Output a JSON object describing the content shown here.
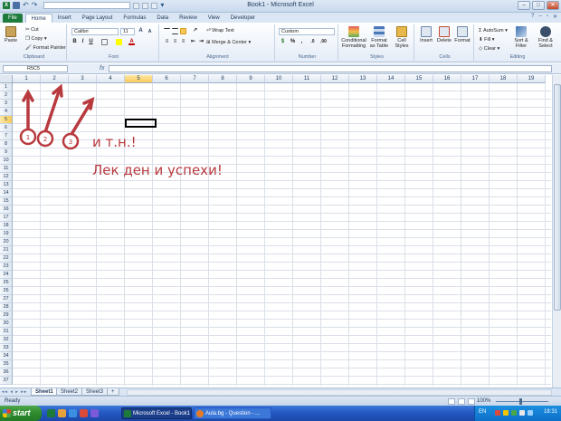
{
  "window": {
    "title": "Book1 - Microsoft Excel"
  },
  "ribbon_tabs": [
    "File",
    "Home",
    "Insert",
    "Page Layout",
    "Formulas",
    "Data",
    "Review",
    "View",
    "Developer"
  ],
  "clipboard": {
    "paste": "Paste",
    "cut": "Cut",
    "copy": "Copy",
    "format_painter": "Format Painter",
    "label": "Clipboard"
  },
  "font": {
    "name": "Calibri",
    "size": "11",
    "label": "Font"
  },
  "alignment": {
    "wrap_text": "Wrap Text",
    "merge_center": "Merge & Center",
    "label": "Alignment"
  },
  "number": {
    "format": "Custom",
    "label": "Number"
  },
  "styles": {
    "conditional": "Conditional Formatting",
    "format_table": "Format as Table",
    "cell_styles": "Cell Styles",
    "label": "Styles"
  },
  "cells_group": {
    "insert": "Insert",
    "delete": "Delete",
    "format": "Format",
    "label": "Cells"
  },
  "editing": {
    "autosum": "AutoSum",
    "fill": "Fill",
    "clear": "Clear",
    "sort_filter": "Sort & Filter",
    "find_select": "Find & Select",
    "label": "Editing"
  },
  "formula_bar": {
    "name_box": "R5C5",
    "fx": "fx",
    "value": ""
  },
  "grid": {
    "columns": [
      "1",
      "2",
      "3",
      "4",
      "5",
      "6",
      "7",
      "8",
      "9",
      "10",
      "11",
      "12",
      "13",
      "14",
      "15",
      "16",
      "17",
      "18",
      "19"
    ],
    "rows": [
      "1",
      "2",
      "3",
      "4",
      "5",
      "6",
      "7",
      "8",
      "9",
      "10",
      "11",
      "12",
      "13",
      "14",
      "15",
      "16",
      "17",
      "18",
      "19",
      "20",
      "21",
      "22",
      "23",
      "24",
      "25",
      "26",
      "27",
      "28",
      "29",
      "30",
      "31",
      "32",
      "33",
      "34",
      "35",
      "36",
      "37"
    ],
    "selected_column": "5",
    "selected_row": "5"
  },
  "annotation": {
    "circle_labels": [
      "1",
      "2",
      "3"
    ],
    "line1": "и т.н.!",
    "line2": "Лек ден и успехи!",
    "color": "#b83a3f"
  },
  "sheets": [
    "Sheet1",
    "Sheet2",
    "Sheet3"
  ],
  "active_sheet": "Sheet1",
  "status": {
    "ready": "Ready",
    "zoom": "100%"
  },
  "taskbar": {
    "start": "start",
    "items": [
      "Microsoft Excel - Book1",
      "Aula.bg - Question - ..."
    ],
    "lang": "EN",
    "clock": "18:31"
  }
}
